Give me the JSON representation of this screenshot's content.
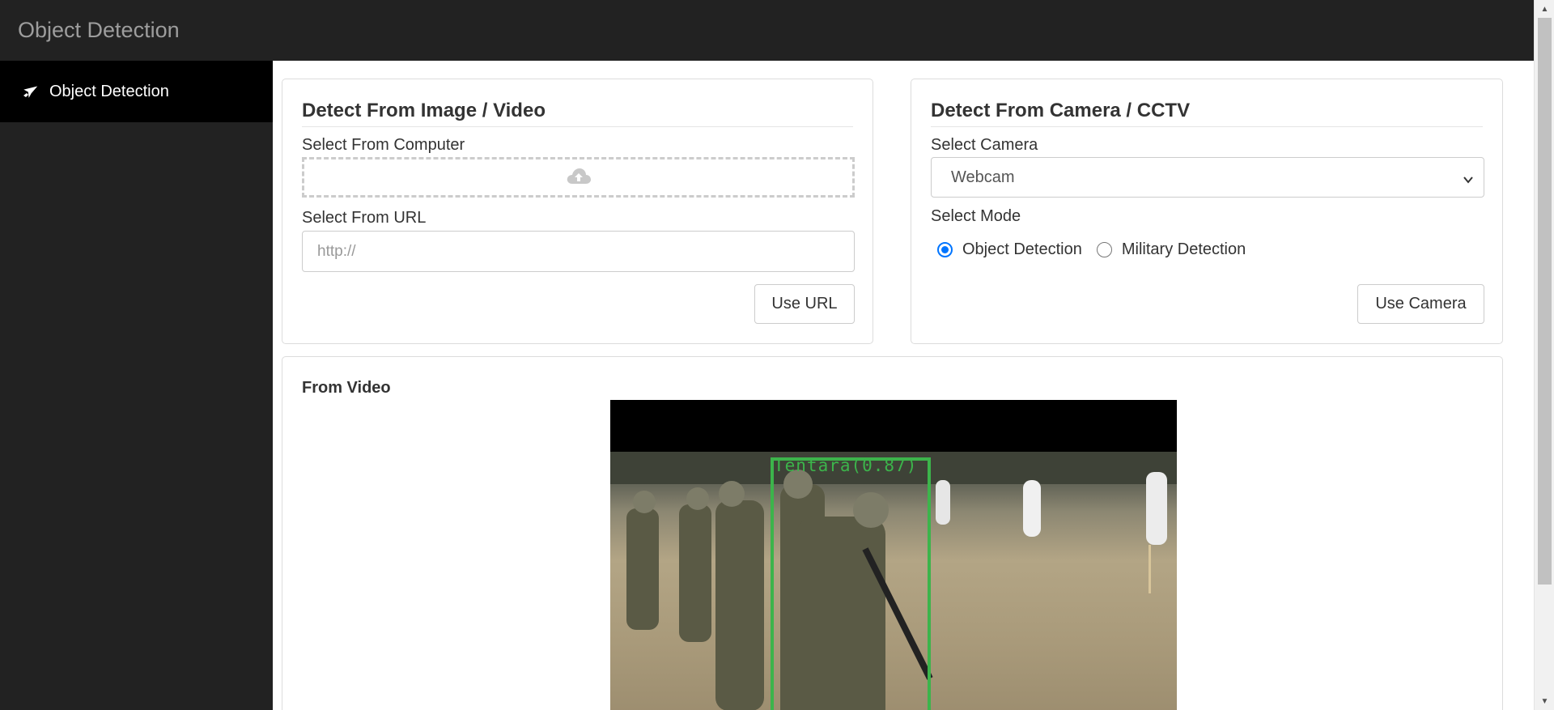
{
  "navbar": {
    "brand": "Object Detection"
  },
  "sidebar": {
    "items": [
      {
        "label": "Object Detection",
        "icon": "plane-icon",
        "active": true
      }
    ]
  },
  "image_card": {
    "title": "Detect From Image / Video",
    "select_computer_label": "Select From Computer",
    "upload_icon": "cloud-upload-icon",
    "select_url_label": "Select From URL",
    "url_placeholder": "http://",
    "url_value": "",
    "use_url_button": "Use URL"
  },
  "camera_card": {
    "title": "Detect From Camera / CCTV",
    "select_camera_label": "Select Camera",
    "selected_camera": "Webcam",
    "select_mode_label": "Select Mode",
    "modes": [
      {
        "label": "Object Detection",
        "checked": true
      },
      {
        "label": "Military Detection",
        "checked": false
      }
    ],
    "use_camera_button": "Use Camera"
  },
  "video_card": {
    "title": "From Video",
    "detection_label": "Tentara(0.87)"
  },
  "colors": {
    "navbar_bg": "#222222",
    "sidebar_active_bg": "#000000",
    "radio_accent": "#0075ff",
    "detection_box": "#3cb44b"
  }
}
